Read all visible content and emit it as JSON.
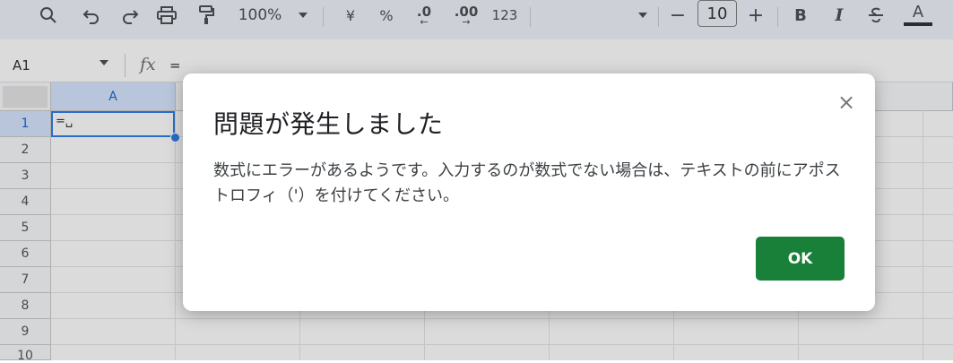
{
  "toolbar": {
    "zoom": "100%",
    "currency_symbol": "¥",
    "percent_symbol": "%",
    "decrease_decimal": ".0",
    "increase_decimal": ".00",
    "number_format": "123",
    "font_size_minus": "−",
    "font_size": "10",
    "font_size_plus": "+",
    "bold": "B",
    "italic": "I",
    "text_color": "A"
  },
  "formula_bar": {
    "name_box": "A1",
    "fx": "fx",
    "formula": "="
  },
  "grid": {
    "columns": [
      "A",
      "",
      "",
      "",
      "",
      "",
      ""
    ],
    "rows": [
      "1",
      "2",
      "3",
      "4",
      "5",
      "6",
      "7",
      "8",
      "9",
      "10"
    ],
    "active_cell_value": "=␣"
  },
  "dialog": {
    "title": "問題が発生しました",
    "message": "数式にエラーがあるようです。入力するのが数式でない場合は、テキストの前にアポストロフィ（'）を付けてください。",
    "close_symbol": "×",
    "ok_label": "OK"
  },
  "colors": {
    "ok_button": "#188038",
    "selection": "#1a73e8",
    "toolbar_bg": "#eef2f9"
  }
}
